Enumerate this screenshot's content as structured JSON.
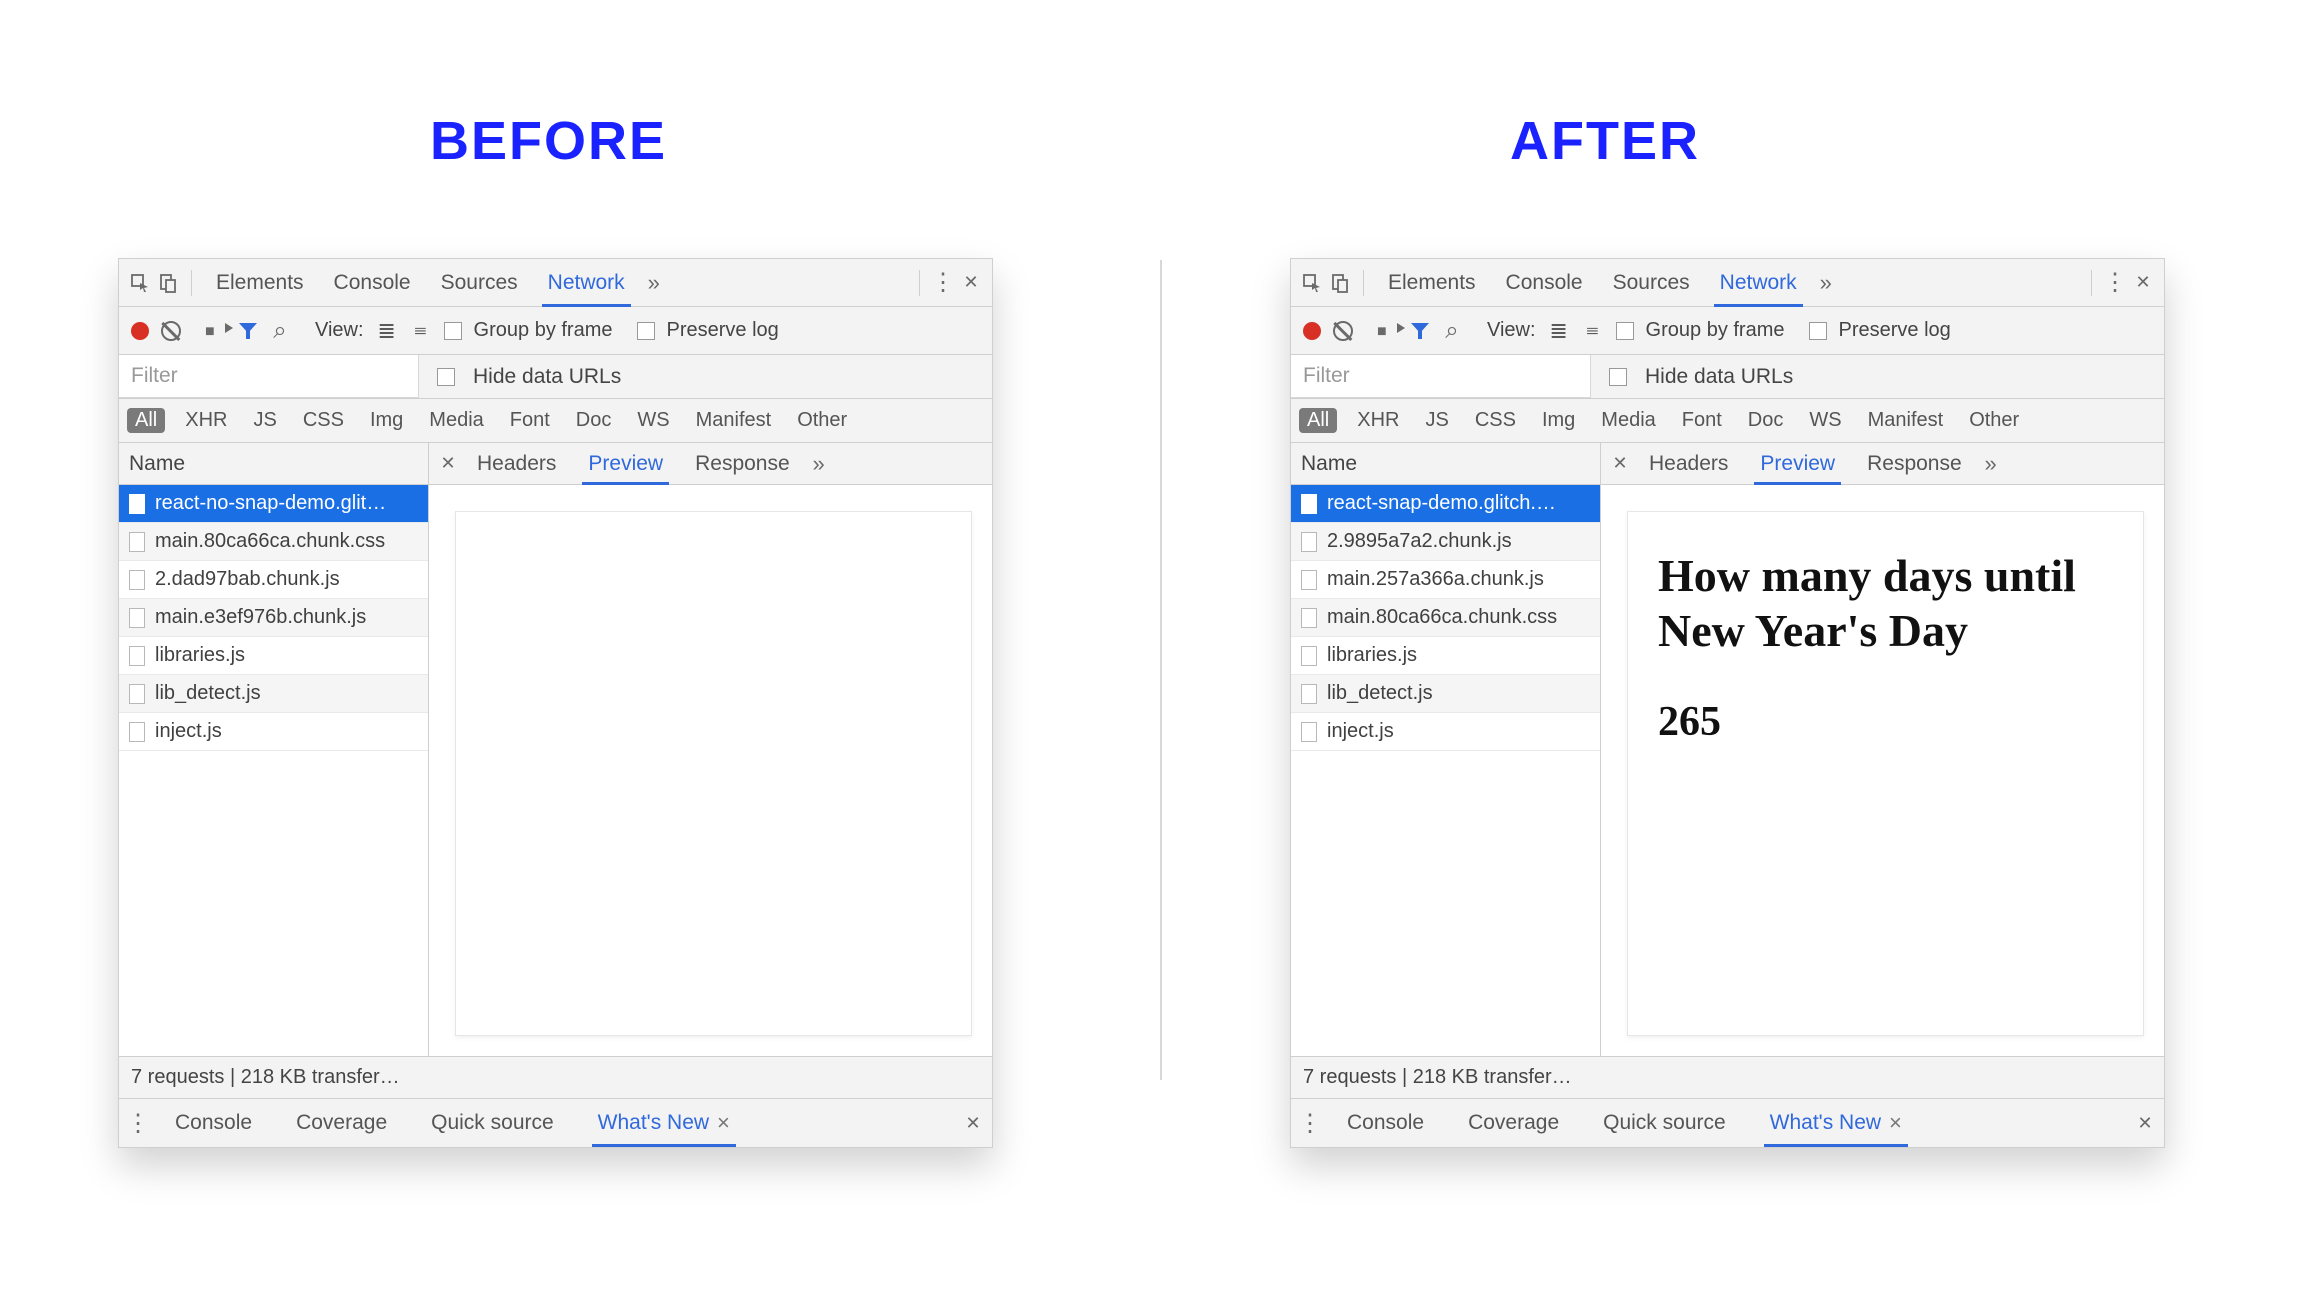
{
  "headings": {
    "before": "BEFORE",
    "after": "AFTER"
  },
  "topTabs": {
    "elements": "Elements",
    "console": "Console",
    "sources": "Sources",
    "network": "Network"
  },
  "toolbar": {
    "view": "View:",
    "groupByFrame": "Group by frame",
    "preserveLog": "Preserve log"
  },
  "filter": {
    "placeholder": "Filter",
    "hideDataUrls": "Hide data URLs"
  },
  "typeFilters": {
    "all": "All",
    "xhr": "XHR",
    "js": "JS",
    "css": "CSS",
    "img": "Img",
    "media": "Media",
    "font": "Font",
    "doc": "Doc",
    "ws": "WS",
    "manifest": "Manifest",
    "other": "Other"
  },
  "columns": {
    "name": "Name"
  },
  "detailTabs": {
    "headers": "Headers",
    "preview": "Preview",
    "response": "Response"
  },
  "drawer": {
    "console": "Console",
    "coverage": "Coverage",
    "quickSource": "Quick source",
    "whatsNew": "What's New"
  },
  "status": "7 requests | 218 KB transfer…",
  "before": {
    "requests": [
      "react-no-snap-demo.glit…",
      "main.80ca66ca.chunk.css",
      "2.dad97bab.chunk.js",
      "main.e3ef976b.chunk.js",
      "libraries.js",
      "lib_detect.js",
      "inject.js"
    ]
  },
  "after": {
    "requests": [
      "react-snap-demo.glitch.…",
      "2.9895a7a2.chunk.js",
      "main.257a366a.chunk.js",
      "main.80ca66ca.chunk.css",
      "libraries.js",
      "lib_detect.js",
      "inject.js"
    ],
    "preview": {
      "title": "How many days until New Year's Day",
      "count": "265"
    }
  }
}
